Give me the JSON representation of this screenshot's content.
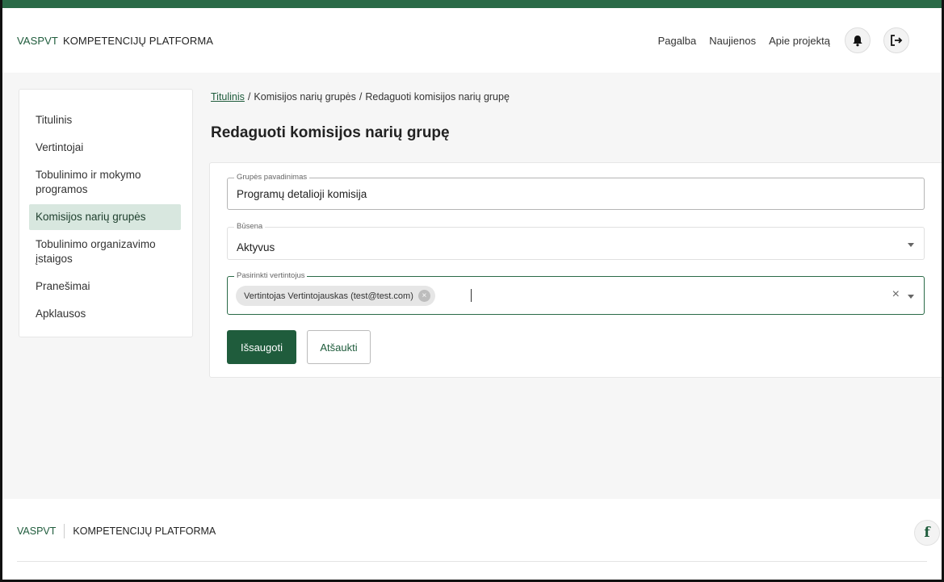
{
  "header": {
    "brand_org": "VASPVT",
    "brand_name": "KOMPETENCIJŲ PLATFORMA",
    "nav": [
      {
        "label": "Pagalba"
      },
      {
        "label": "Naujienos"
      },
      {
        "label": "Apie projektą"
      }
    ],
    "icons": {
      "notifications": "bell-icon",
      "logout": "logout-icon"
    }
  },
  "sidebar": {
    "items": [
      {
        "label": "Titulinis"
      },
      {
        "label": "Vertintojai"
      },
      {
        "label": "Tobulinimo ir mokymo programos"
      },
      {
        "label": "Komisijos narių grupės",
        "active": true
      },
      {
        "label": "Tobulinimo organizavimo įstaigos"
      },
      {
        "label": "Pranešimai"
      },
      {
        "label": "Apklausos"
      }
    ]
  },
  "breadcrumb": {
    "home": "Titulinis",
    "separator": "/",
    "level1": "Komisijos narių grupės",
    "current": "Redaguoti komisijos narių grupę"
  },
  "page_title": "Redaguoti komisijos narių grupę",
  "form": {
    "group_name": {
      "label": "Grupės pavadinimas",
      "value": "Programų detalioji komisija"
    },
    "status": {
      "label": "Būsena",
      "value": "Aktyvus"
    },
    "assessors": {
      "label": "Pasirinkti vertintojus",
      "chips": [
        {
          "label": "Vertintojas Vertintojauskas (test@test.com)"
        }
      ]
    },
    "save_label": "Išsaugoti",
    "cancel_label": "Atšaukti"
  },
  "footer": {
    "brand_org": "VASPVT",
    "brand_name": "KOMPETENCIJŲ PLATFORMA",
    "social": "facebook-icon"
  },
  "colors": {
    "brand_green": "#1f5c3c",
    "top_bar": "#2a6a47",
    "active_nav_bg": "#d8e7df"
  }
}
